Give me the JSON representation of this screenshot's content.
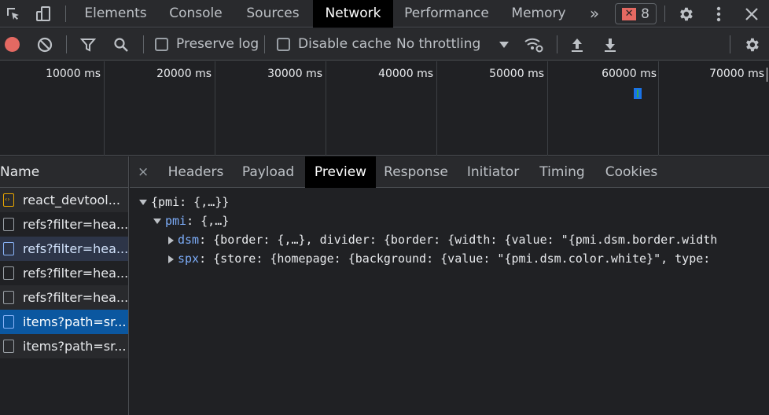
{
  "top_tabs": [
    "Elements",
    "Console",
    "Sources",
    "Network",
    "Performance",
    "Memory"
  ],
  "active_top_tab": "Network",
  "more_tabs": "»",
  "error_count": "8",
  "toolbar": {
    "preserve_log": "Preserve log",
    "disable_cache": "Disable cache",
    "throttling": "No throttling"
  },
  "overview": {
    "labels": [
      "10000 ms",
      "20000 ms",
      "30000 ms",
      "40000 ms",
      "50000 ms",
      "60000 ms",
      "70000 ms"
    ]
  },
  "requests": {
    "header": "Name",
    "rows": [
      {
        "name": "react_devtool..."
      },
      {
        "name": "refs?filter=hea..."
      },
      {
        "name": "refs?filter=hea..."
      },
      {
        "name": "refs?filter=hea..."
      },
      {
        "name": "refs?filter=hea..."
      },
      {
        "name": "items?path=sr..."
      },
      {
        "name": "items?path=sr..."
      }
    ]
  },
  "detail": {
    "close": "×",
    "tabs": [
      "Headers",
      "Payload",
      "Preview",
      "Response",
      "Initiator",
      "Timing",
      "Cookies"
    ],
    "active_tab": "Preview",
    "preview": {
      "root": "{pmi: {,…}}",
      "pmi_key": "pmi",
      "pmi_value": ": {,…}",
      "dsm_key": "dsm",
      "dsm_value": ": {border: {,…}, divider: {border: {width: {value: \"{pmi.dsm.border.width",
      "spx_key": "spx",
      "spx_value": ": {store: {homepage: {background: {value: \"{pmi.dsm.color.white}\", type:"
    }
  },
  "colors": {
    "accent": "#0b57a0",
    "error": "#e46962",
    "record": "#e46962",
    "key": "#7cacf8"
  }
}
